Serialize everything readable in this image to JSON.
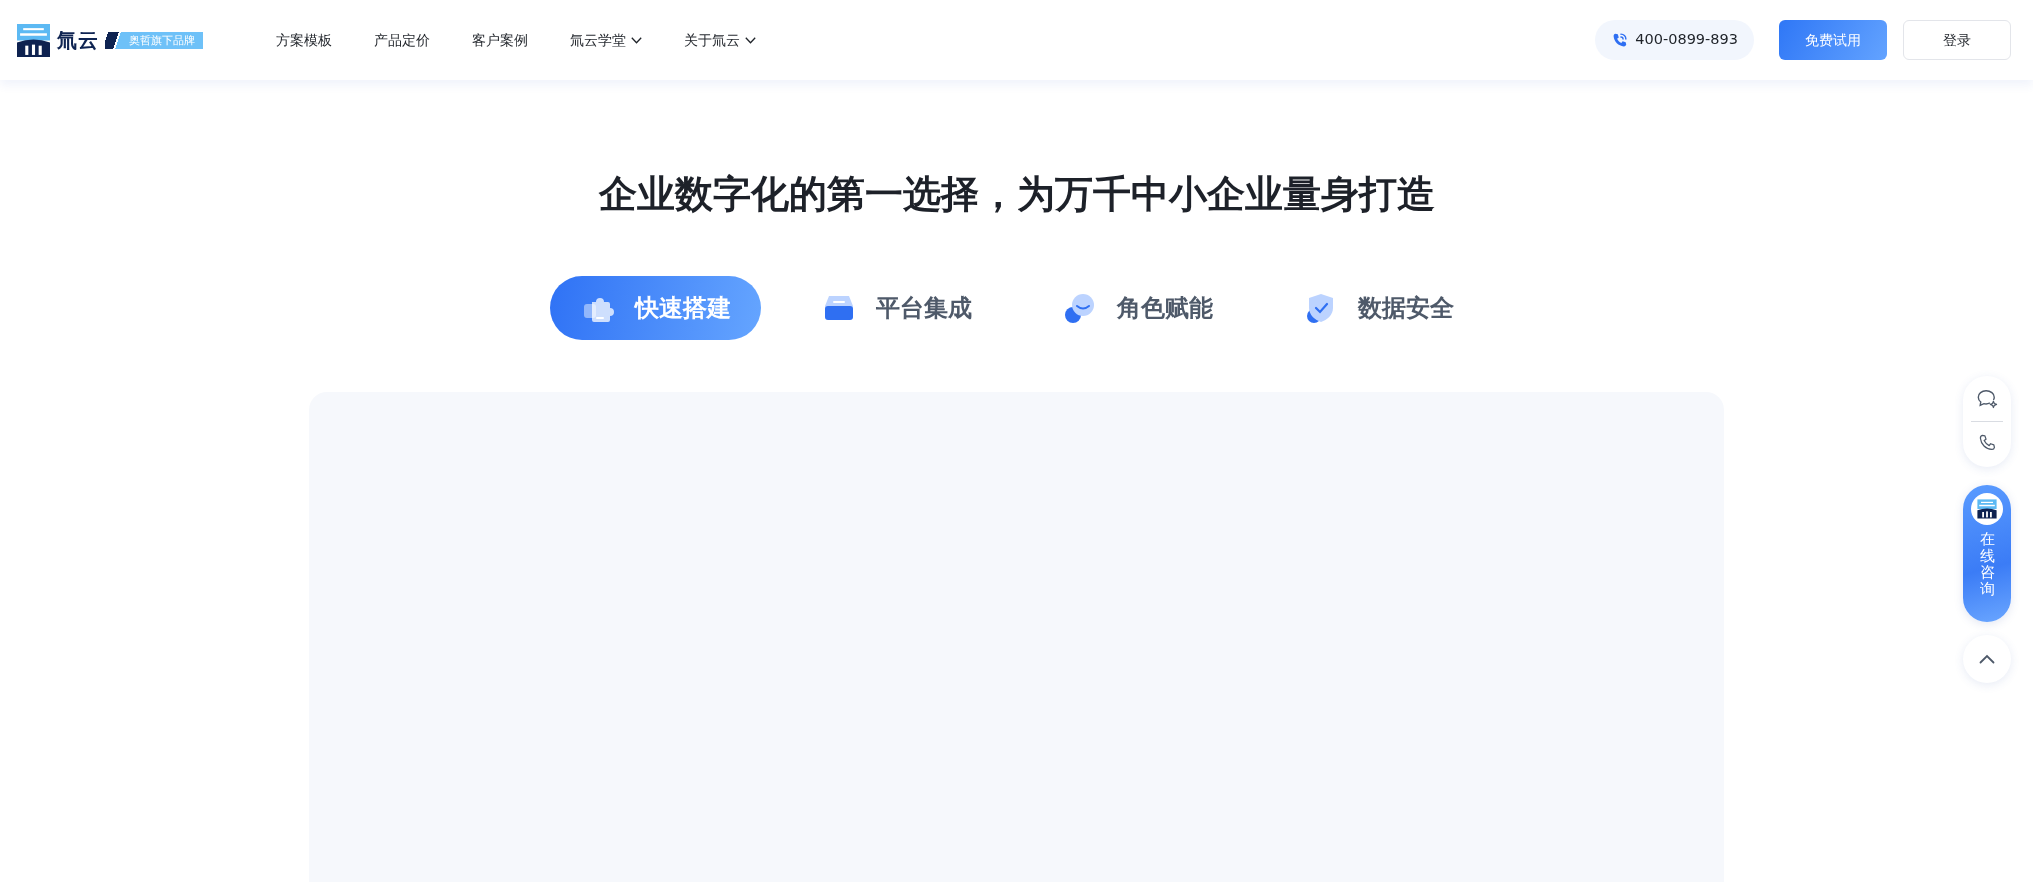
{
  "header": {
    "logo": {
      "name": "氚云",
      "badge": "奥哲旗下品牌"
    },
    "nav": [
      {
        "label": "方案模板",
        "dropdown": false
      },
      {
        "label": "产品定价",
        "dropdown": false
      },
      {
        "label": "客户案例",
        "dropdown": false
      },
      {
        "label": "氚云学堂",
        "dropdown": true
      },
      {
        "label": "关于氚云",
        "dropdown": true
      }
    ],
    "phone": "400-0899-893",
    "buttons": [
      {
        "label": "免费试用",
        "kind": "primary"
      },
      {
        "label": "登录",
        "kind": "outline"
      }
    ]
  },
  "hero": {
    "title": "企业数字化的第一选择，为万千中小企业量身打造",
    "tabs": [
      {
        "label": "快速搭建",
        "selected": true
      },
      {
        "label": "平台集成",
        "selected": false
      },
      {
        "label": "角色赋能",
        "selected": false
      },
      {
        "label": "数据安全",
        "selected": false
      }
    ]
  },
  "side_tools": {
    "consult": "在线咨询"
  }
}
